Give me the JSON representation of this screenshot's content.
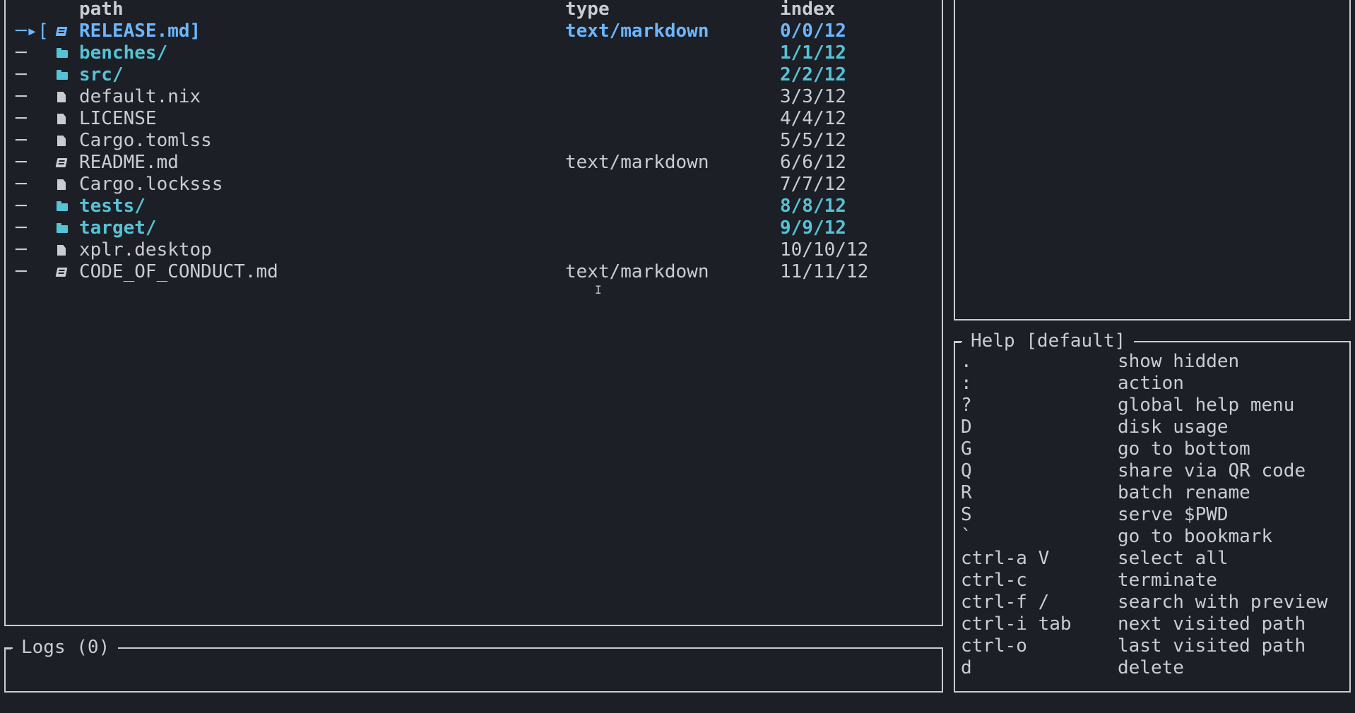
{
  "main": {
    "headers": {
      "path": "path",
      "type": "type",
      "index": "index"
    },
    "rows": [
      {
        "tree": "─▸[",
        "icon": "markdown-file-icon",
        "name": "RELEASE.md",
        "suffix": "]",
        "type": "text/markdown",
        "index": "0/0/12",
        "style": "focused"
      },
      {
        "tree": "─",
        "icon": "folder-icon",
        "name": "benches/",
        "suffix": "",
        "type": "",
        "index": "1/1/12",
        "style": "dir"
      },
      {
        "tree": "─",
        "icon": "folder-icon",
        "name": "src/",
        "suffix": "",
        "type": "",
        "index": "2/2/12",
        "style": "dir"
      },
      {
        "tree": "─",
        "icon": "file-icon",
        "name": "default.nix",
        "suffix": "",
        "type": "",
        "index": "3/3/12",
        "style": "plain"
      },
      {
        "tree": "─",
        "icon": "file-icon",
        "name": "LICENSE",
        "suffix": "",
        "type": "",
        "index": "4/4/12",
        "style": "plain"
      },
      {
        "tree": "─",
        "icon": "file-icon",
        "name": "Cargo.tomlss",
        "suffix": "",
        "type": "",
        "index": "5/5/12",
        "style": "plain"
      },
      {
        "tree": "─",
        "icon": "markdown-file-icon",
        "name": "README.md",
        "suffix": "",
        "type": "text/markdown",
        "index": "6/6/12",
        "style": "plain"
      },
      {
        "tree": "─",
        "icon": "file-icon",
        "name": "Cargo.locksss",
        "suffix": "",
        "type": "",
        "index": "7/7/12",
        "style": "plain"
      },
      {
        "tree": "─",
        "icon": "folder-icon",
        "name": "tests/",
        "suffix": "",
        "type": "",
        "index": "8/8/12",
        "style": "dir"
      },
      {
        "tree": "─",
        "icon": "folder-icon",
        "name": "target/",
        "suffix": "",
        "type": "",
        "index": "9/9/12",
        "style": "dir"
      },
      {
        "tree": "─",
        "icon": "file-icon",
        "name": "xplr.desktop",
        "suffix": "",
        "type": "",
        "index": "10/10/12",
        "style": "plain"
      },
      {
        "tree": "─",
        "icon": "markdown-file-icon",
        "name": "CODE_OF_CONDUCT.md",
        "suffix": "",
        "type": "text/markdown",
        "index": "11/11/12",
        "style": "plain"
      }
    ]
  },
  "help": {
    "title": "Help [default]",
    "items": [
      {
        "key": ".",
        "desc": "show hidden"
      },
      {
        "key": ":",
        "desc": "action"
      },
      {
        "key": "?",
        "desc": "global help menu"
      },
      {
        "key": "D",
        "desc": "disk usage"
      },
      {
        "key": "G",
        "desc": "go to bottom"
      },
      {
        "key": "Q",
        "desc": "share via QR code"
      },
      {
        "key": "R",
        "desc": "batch rename"
      },
      {
        "key": "S",
        "desc": "serve $PWD"
      },
      {
        "key": "`",
        "desc": "go to bookmark"
      },
      {
        "key": "ctrl-a V",
        "desc": "select all"
      },
      {
        "key": "ctrl-c",
        "desc": "terminate"
      },
      {
        "key": "ctrl-f /",
        "desc": "search with preview"
      },
      {
        "key": "ctrl-i tab",
        "desc": "next visited path"
      },
      {
        "key": "ctrl-o",
        "desc": "last visited path"
      },
      {
        "key": "d",
        "desc": "delete"
      }
    ]
  },
  "logs": {
    "title": "Logs (0)"
  },
  "colors": {
    "background": "#1c1f25",
    "text": "#c8ccd4",
    "focus": "#6cb6ff",
    "directory": "#56c2d6"
  }
}
